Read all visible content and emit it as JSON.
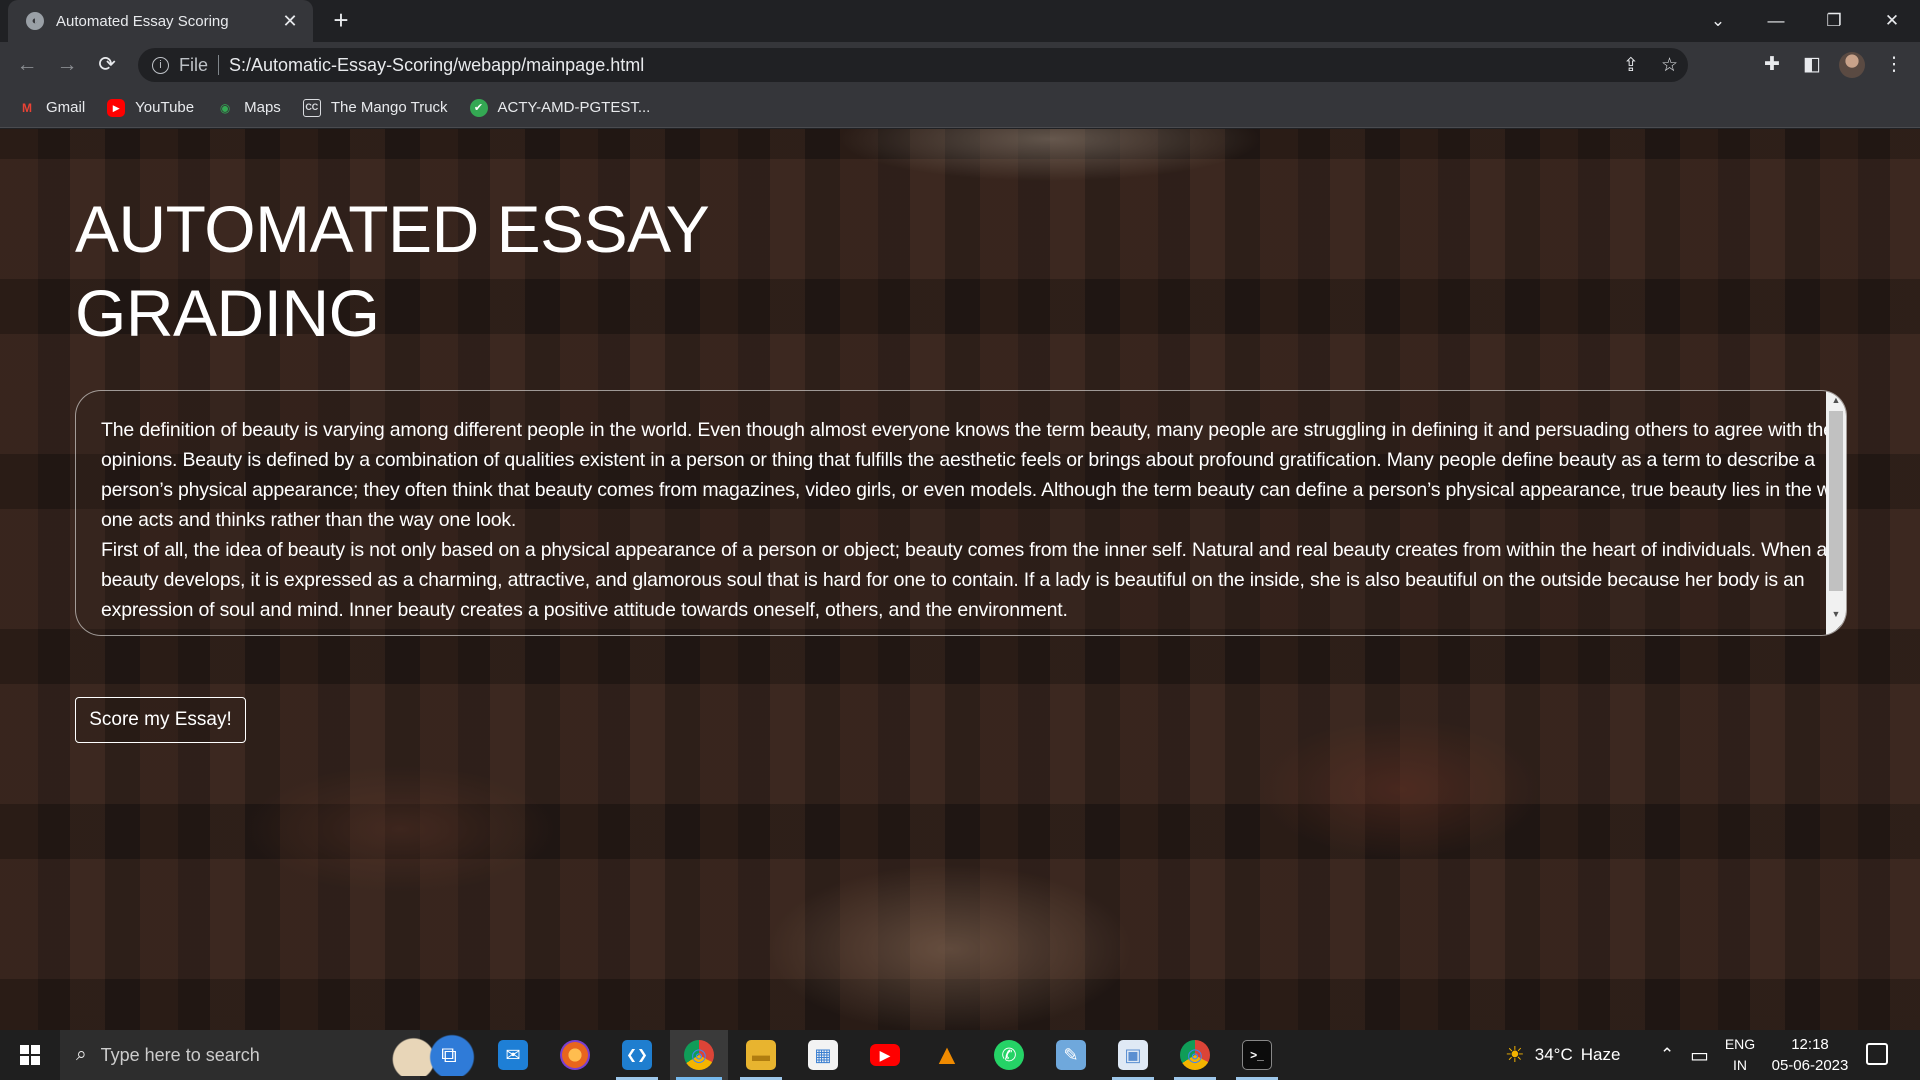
{
  "browser": {
    "tab": {
      "title": "Automated Essay Scoring",
      "close": "✕"
    },
    "new_tab": "+",
    "window_controls": {
      "dropdown": "⌄",
      "minimize": "—",
      "restore": "❐",
      "close": "✕"
    },
    "nav": {
      "back": "←",
      "forward": "→",
      "reload": "⟳"
    },
    "address": {
      "info": "i",
      "scheme": "File",
      "url": "S:/Automatic-Essay-Scoring/webapp/mainpage.html"
    },
    "toolbar_icons": {
      "share": "⇪",
      "bookmark_star": "☆",
      "extensions": "✚",
      "side_panel": "◧",
      "menu": "⋮"
    },
    "bookmarks": [
      {
        "label": "Gmail",
        "icon": "gmail-icon",
        "glyph": "M",
        "color": "#ea4335"
      },
      {
        "label": "YouTube",
        "icon": "youtube-icon",
        "glyph": "▶",
        "color": "#ff0000"
      },
      {
        "label": "Maps",
        "icon": "maps-icon",
        "glyph": "◉",
        "color": "#34a853"
      },
      {
        "label": "The Mango Truck",
        "icon": "cc-icon",
        "glyph": "CC",
        "color": "#5f6368"
      },
      {
        "label": "ACTY-AMD-PGTEST...",
        "icon": "check-icon",
        "glyph": "✔",
        "color": "#34a853"
      }
    ]
  },
  "page": {
    "title": "AUTOMATED ESSAY GRADING",
    "essay": "The definition of beauty is varying among different people in the world. Even though almost everyone knows the term beauty, many people are struggling in defining it and persuading others to agree with their opinions. Beauty is defined by a combination of qualities existent in a person or thing that fulfills the aesthetic feels or brings about profound gratification. Many people define beauty as a term to describe a person’s physical appearance; they often think that beauty comes from magazines, video girls, or even models. Although the term beauty can define a person’s physical appearance, true beauty lies in the way one acts and thinks rather than the way one look.\nFirst of all, the idea of beauty is not only based on a physical appearance of a person or object; beauty comes from the inner self. Natural and real beauty creates from within the heart of individuals. When a real beauty develops, it is expressed as a charming, attractive, and glamorous soul that is hard for one to contain. If a lady is beautiful on the inside, she is also beautiful on the outside because her body is an expression of soul and mind. Inner beauty creates a positive attitude towards oneself, others, and the environment.",
    "score_button": "Score my Essay!",
    "scroll_up": "▲",
    "scroll_down": "▼",
    "resize": "◢"
  },
  "taskbar": {
    "search_placeholder": "Type here to search",
    "search_glyph": "⌕",
    "apps": [
      {
        "name": "task-view",
        "glyph": "⧉",
        "color": "transparent"
      },
      {
        "name": "mail",
        "glyph": "✉",
        "color": "#1e7fd6"
      },
      {
        "name": "firefox",
        "glyph": "●",
        "color": "#e8651d"
      },
      {
        "name": "vscode",
        "glyph": "❮❯",
        "color": "#1f7ecf"
      },
      {
        "name": "chrome",
        "glyph": "◎",
        "color": "#db4437"
      },
      {
        "name": "file-explorer",
        "glyph": "▬",
        "color": "#e8b42f"
      },
      {
        "name": "microsoft-store",
        "glyph": "▦",
        "color": "#3b7fd1"
      },
      {
        "name": "youtube",
        "glyph": "▶",
        "color": "#ff0000"
      },
      {
        "name": "vlc",
        "glyph": "▲",
        "color": "#f08a00"
      },
      {
        "name": "whatsapp",
        "glyph": "✆",
        "color": "#25d366"
      },
      {
        "name": "notes",
        "glyph": "✎",
        "color": "#6fa8dc"
      },
      {
        "name": "photos",
        "glyph": "▣",
        "color": "#5b8fd1"
      },
      {
        "name": "chrome-profile",
        "glyph": "◎",
        "color": "#db4437"
      },
      {
        "name": "terminal",
        "glyph": ">_",
        "color": "#0c0c0c"
      }
    ],
    "weather": {
      "icon": "☀",
      "temp": "34°C",
      "condition": "Haze"
    },
    "tray_chevron": "⌃",
    "battery": "▭",
    "language": {
      "line1": "ENG",
      "line2": "IN"
    },
    "clock": {
      "time": "12:18",
      "date": "05-06-2023"
    }
  }
}
